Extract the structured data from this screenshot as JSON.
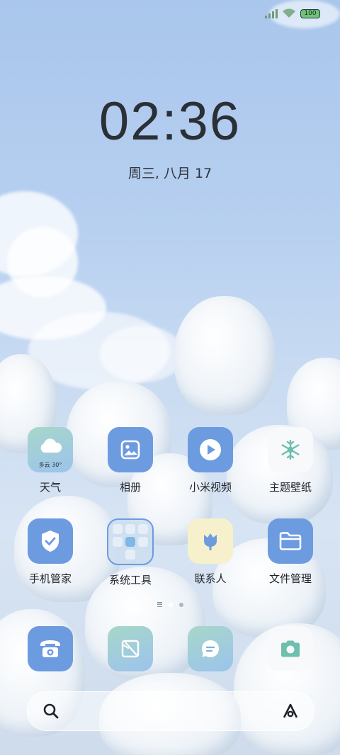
{
  "status_bar": {
    "battery": "100"
  },
  "lock_clock": {
    "time": "02:36",
    "date": "周三, 八月 17"
  },
  "apps_row1": [
    {
      "label": "天气",
      "icon": "weather-cloud-icon",
      "widget_text": "多云 30°"
    },
    {
      "label": "相册",
      "icon": "gallery-icon"
    },
    {
      "label": "小米视频",
      "icon": "video-play-icon"
    },
    {
      "label": "主题壁纸",
      "icon": "snowflake-icon"
    }
  ],
  "apps_row2": [
    {
      "label": "手机管家",
      "icon": "shield-check-icon"
    },
    {
      "label": "系统工具",
      "icon": "folder-grid-icon"
    },
    {
      "label": "联系人",
      "icon": "tulip-icon"
    },
    {
      "label": "文件管理",
      "icon": "folder-icon"
    }
  ],
  "dock": [
    {
      "icon": "phone-icon"
    },
    {
      "icon": "notes-icon"
    },
    {
      "icon": "message-icon"
    },
    {
      "icon": "camera-icon"
    }
  ],
  "page_indicator": {
    "pages": 2,
    "current": 1
  },
  "colors": {
    "accent_blue": "#6d9be0",
    "teal": "#7bbfb0",
    "label_text": "#1f2329"
  }
}
